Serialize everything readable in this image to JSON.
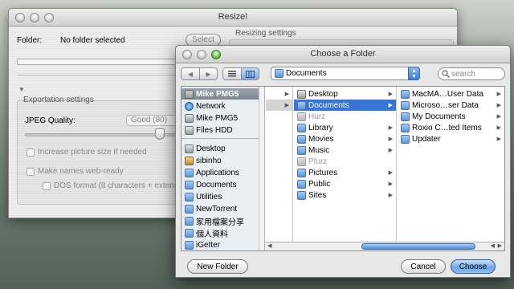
{
  "back_window": {
    "title": "Resize!",
    "folder_label": "Folder:",
    "folder_value": "No folder selected",
    "select_button": "Select",
    "resizing_settings": "Resizing settings",
    "exportation_settings": "Exportation settings",
    "jpeg_quality_label": "JPEG Quality:",
    "jpeg_quality_value": "Good (80)",
    "increase_size_label": "Increase picture size if needed",
    "web_ready_label": "Make names web-ready",
    "dos_format_label": "DOS format (8 characters + extens"
  },
  "dialog": {
    "title": "Choose a Folder",
    "location": "Documents",
    "search_placeholder": "search",
    "sidebar": {
      "devices": [
        {
          "label": "Mike PMG5",
          "icon": "computer-icon",
          "selected": true
        },
        {
          "label": "Network",
          "icon": "globe-icon"
        },
        {
          "label": "Mike PMG5",
          "icon": "drive-icon"
        },
        {
          "label": "Files HDD",
          "icon": "drive-icon"
        }
      ],
      "places": [
        {
          "label": "Desktop",
          "icon": "desktop-icon"
        },
        {
          "label": "sibinho",
          "icon": "home-icon"
        },
        {
          "label": "Applications",
          "icon": "applications-icon"
        },
        {
          "label": "Documents",
          "icon": "documents-icon"
        },
        {
          "label": "Utilities",
          "icon": "folder-icon"
        },
        {
          "label": "NewTorrent",
          "icon": "folder-icon"
        },
        {
          "label": "家用檔案分享",
          "icon": "folder-icon"
        },
        {
          "label": "個人資料",
          "icon": "folder-icon"
        },
        {
          "label": "iGetter",
          "icon": "folder-icon"
        }
      ]
    },
    "column2": [
      {
        "label": "Desktop",
        "arrow": true
      },
      {
        "label": "Documents",
        "arrow": true,
        "selected": true
      },
      {
        "label": "Hurz",
        "dim": true
      },
      {
        "label": "Library",
        "arrow": true
      },
      {
        "label": "Movies",
        "arrow": true
      },
      {
        "label": "Music",
        "arrow": true
      },
      {
        "label": "Pfurz",
        "dim": true
      },
      {
        "label": "Pictures",
        "arrow": true
      },
      {
        "label": "Public",
        "arrow": true
      },
      {
        "label": "Sites",
        "arrow": true
      }
    ],
    "column3": [
      {
        "label": "MacMA…User Data",
        "arrow": true
      },
      {
        "label": "Microso…ser Data",
        "arrow": true
      },
      {
        "label": "My Documents",
        "arrow": true
      },
      {
        "label": "Roxio C…ted Items",
        "arrow": true
      },
      {
        "label": "Updater",
        "arrow": true
      }
    ],
    "new_folder_button": "New Folder",
    "cancel_button": "Cancel",
    "choose_button": "Choose"
  }
}
